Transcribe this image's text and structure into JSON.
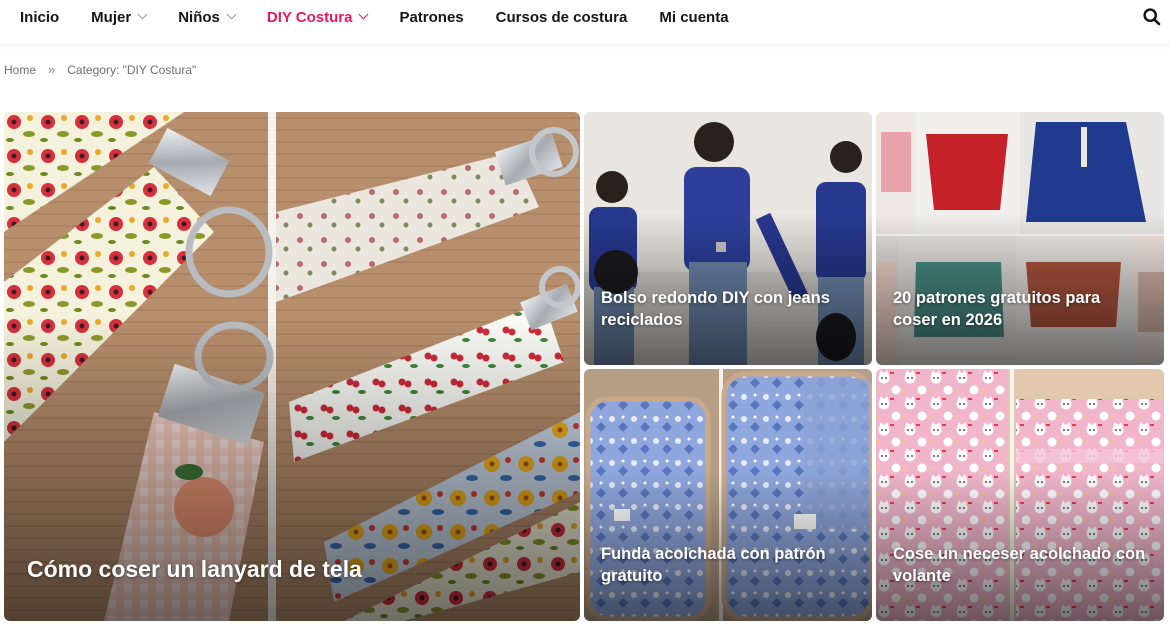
{
  "nav": {
    "items": [
      {
        "label": "Inicio",
        "dropdown": false,
        "active": false
      },
      {
        "label": "Mujer",
        "dropdown": true,
        "active": false
      },
      {
        "label": "Niños",
        "dropdown": true,
        "active": false
      },
      {
        "label": "DIY Costura",
        "dropdown": true,
        "active": true
      },
      {
        "label": "Patrones",
        "dropdown": false,
        "active": false
      },
      {
        "label": "Cursos de costura",
        "dropdown": false,
        "active": false
      },
      {
        "label": "Mi cuenta",
        "dropdown": false,
        "active": false
      }
    ],
    "search_icon": "search-icon"
  },
  "breadcrumb": {
    "home": "Home",
    "separator": "»",
    "current": "Category: \"DIY Costura\""
  },
  "posts": [
    {
      "title": "Cómo coser un lanyard de tela"
    },
    {
      "title": "Bolso redondo DIY con jeans reciclados"
    },
    {
      "title": "20 patrones gratuitos para coser en 2026"
    },
    {
      "title": "Funda acolchada con patrón gratuito"
    },
    {
      "title": "Cose un neceser acolchado con volante"
    }
  ],
  "colors": {
    "accent": "#e8195e",
    "text": "#161616",
    "breadcrumb": "#6d6d6d"
  }
}
